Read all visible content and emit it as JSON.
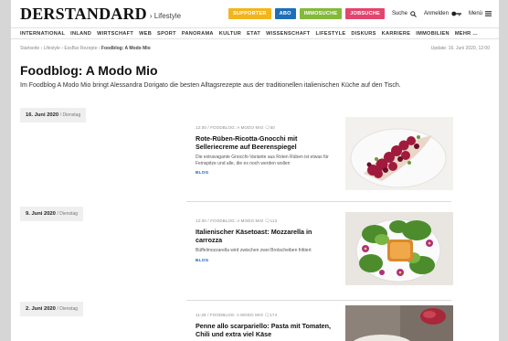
{
  "header": {
    "logo": "DERSTANDARD",
    "section": "› Lifestyle",
    "pills": [
      {
        "label": "SUPPORTER",
        "color": "#f2b51c"
      },
      {
        "label": "ABO",
        "color": "#1d6fb8"
      },
      {
        "label": "IMMOSUCHE",
        "color": "#84b93a"
      },
      {
        "label": "JOBSUCHE",
        "color": "#e2456d"
      }
    ],
    "search_label": "Suche",
    "login_label": "Anmelden",
    "menu_label": "Menü"
  },
  "nav": [
    "INTERNATIONAL",
    "INLAND",
    "WIRTSCHAFT",
    "WEB",
    "SPORT",
    "PANORAMA",
    "KULTUR",
    "ETAT",
    "WISSENSCHAFT",
    "LIFESTYLE",
    "DISKURS",
    "KARRIERE",
    "IMMOBILIEN",
    "MEHR ..."
  ],
  "breadcrumb": {
    "prefix": "Startseite › Lifestyle › EssBar Rezepte › ",
    "current": "Foodblog: A Modo Mio"
  },
  "update": "Update: 16. Juni 2020, 12:00",
  "title": "Foodblog: A Modo Mio",
  "intro": "Im Foodblog A Modo Mio bringt Alessandra Dorigato die besten Alltagsrezepte aus der traditionellen italienischen Küche auf den Tisch.",
  "entries": [
    {
      "date": "16. Juni 2020",
      "weekday": "/ Dienstag",
      "meta": "12:00 / FOODBLOG: A MODO MIO",
      "comments": "50",
      "title": "Rote-Rüben-Ricotta-Gnocchi mit Selleriecreme auf Beerenspiegel",
      "teaser": "Die extravagante Gnocchi-Variante aus Roten Rüben ist etwas für Feinspitze und alle, die es noch werden wollen",
      "label": "BLOG"
    },
    {
      "date": "9. Juni 2020",
      "weekday": "/ Dienstag",
      "meta": "12:00 / FOODBLOG: A MODO MIO",
      "comments": "113",
      "title": "Italienischer Käsetoast: Mozzarella in carrozza",
      "teaser": "Büffelmozzarella wird zwischen zwei Brotscheiben frittiert",
      "label": "BLOG"
    },
    {
      "date": "2. Juni 2020",
      "weekday": "/ Dienstag",
      "meta": "11:28 / FOODBLOG: A MODO MIO",
      "comments": "174",
      "title": "Penne allo scarpariello: Pasta mit Tomaten, Chili und extra viel Käse",
      "teaser": "",
      "label": ""
    }
  ]
}
